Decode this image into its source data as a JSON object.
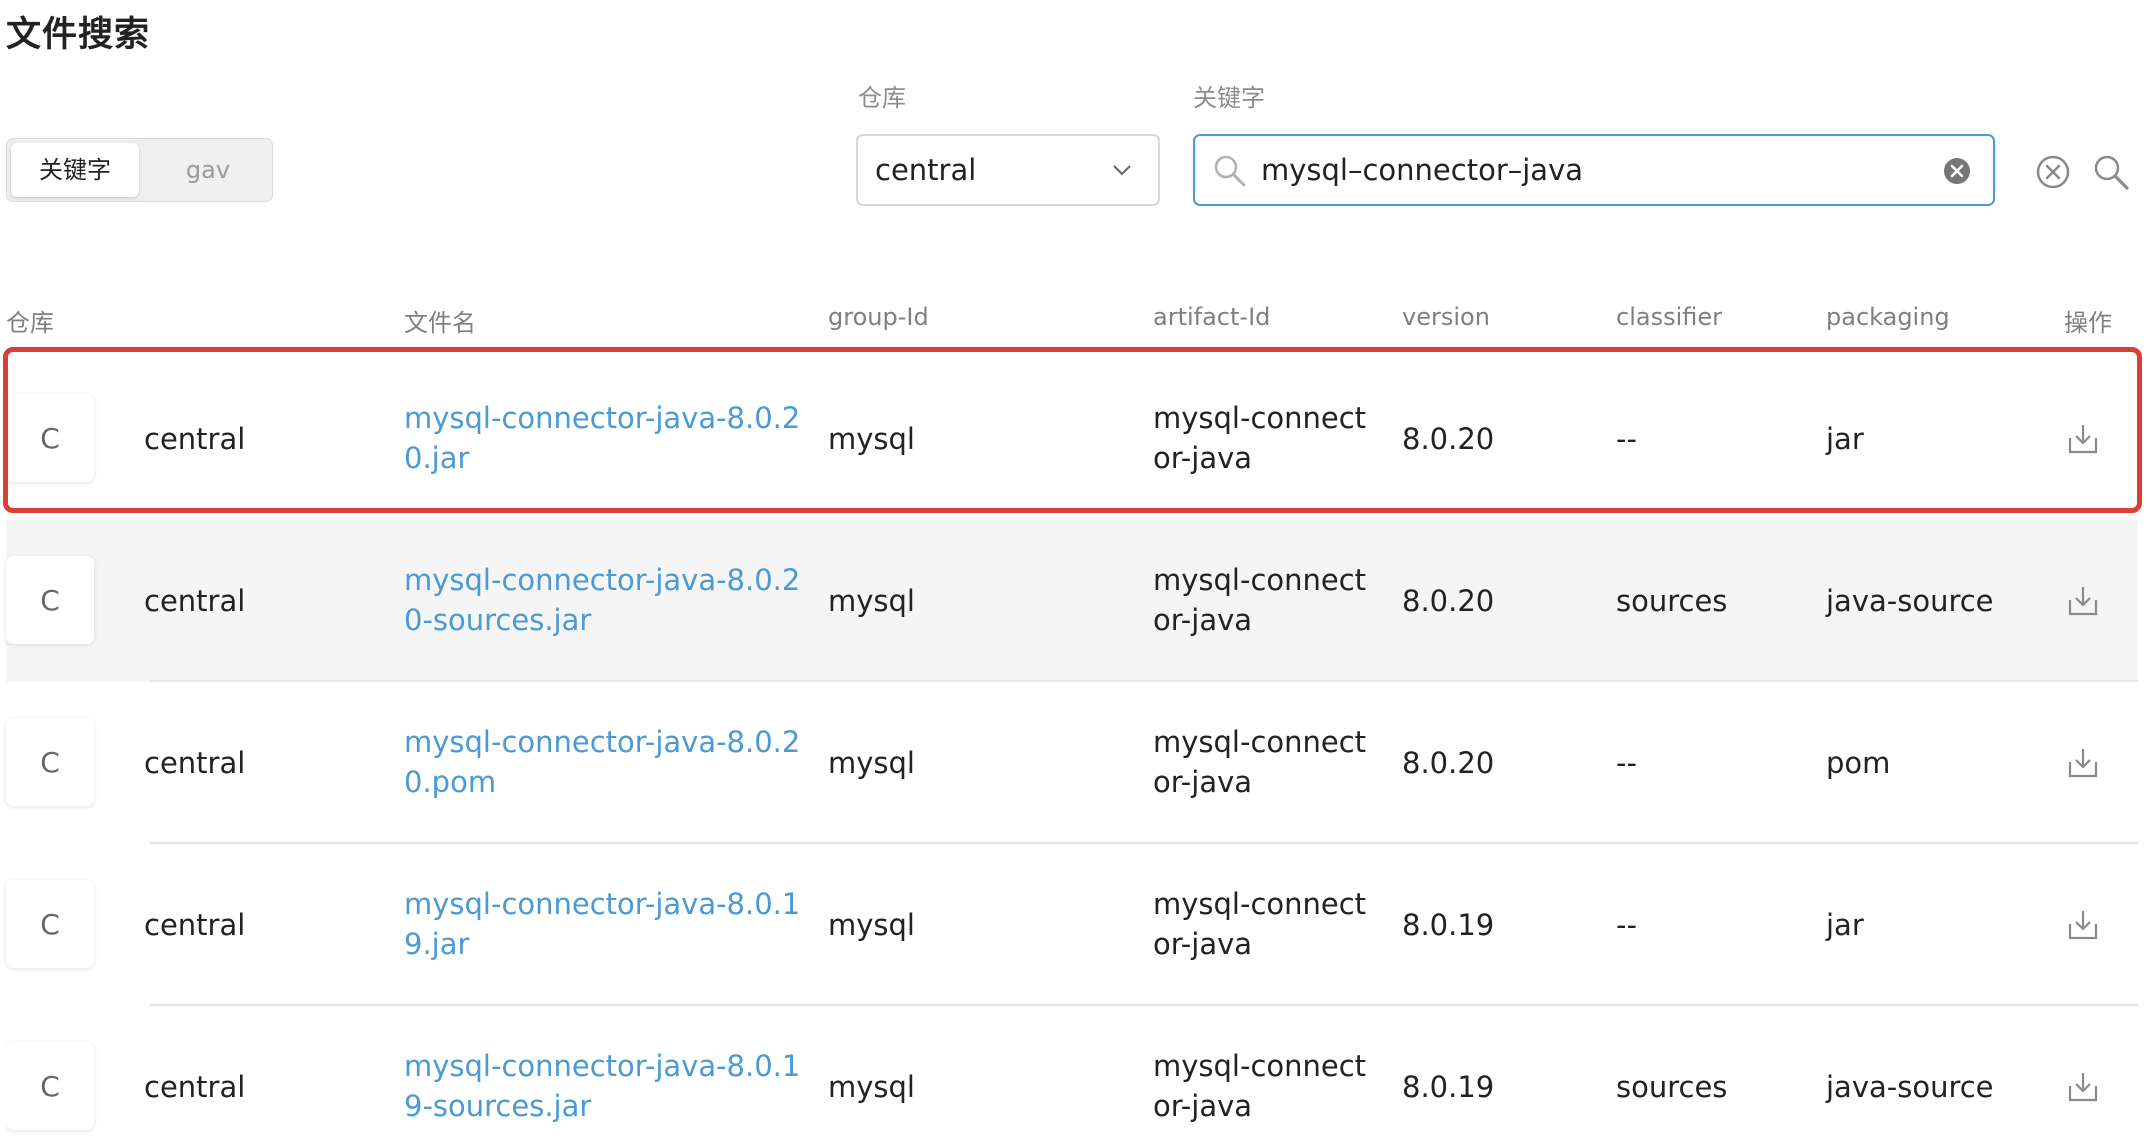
{
  "page": {
    "title": "文件搜索"
  },
  "mode_switch": {
    "options": [
      "关键字",
      "gav"
    ],
    "active": "关键字"
  },
  "filters": {
    "repo_label": "仓库",
    "repo_value": "central",
    "keyword_label": "关键字",
    "keyword_value": "mysql–connector–java"
  },
  "table": {
    "headers": [
      "仓库",
      "文件名",
      "group-Id",
      "artifact-Id",
      "version",
      "classifier",
      "packaging",
      "操作"
    ],
    "rows": [
      {
        "badge": "C",
        "repo": "central",
        "file_line1": "mysql-connector-java-8.0.2",
        "file_line2": "0.jar",
        "group": "mysql",
        "artifact_line1": "mysql-connect",
        "artifact_line2": "or-java",
        "version": "8.0.20",
        "classifier": "--",
        "packaging": "jar"
      },
      {
        "badge": "C",
        "repo": "central",
        "file_line1": "mysql-connector-java-8.0.2",
        "file_line2": "0-sources.jar",
        "group": "mysql",
        "artifact_line1": "mysql-connect",
        "artifact_line2": "or-java",
        "version": "8.0.20",
        "classifier": "sources",
        "packaging": "java-source"
      },
      {
        "badge": "C",
        "repo": "central",
        "file_line1": "mysql-connector-java-8.0.2",
        "file_line2": "0.pom",
        "group": "mysql",
        "artifact_line1": "mysql-connect",
        "artifact_line2": "or-java",
        "version": "8.0.20",
        "classifier": "--",
        "packaging": "pom"
      },
      {
        "badge": "C",
        "repo": "central",
        "file_line1": "mysql-connector-java-8.0.1",
        "file_line2": "9.jar",
        "group": "mysql",
        "artifact_line1": "mysql-connect",
        "artifact_line2": "or-java",
        "version": "8.0.19",
        "classifier": "--",
        "packaging": "jar"
      },
      {
        "badge": "C",
        "repo": "central",
        "file_line1": "mysql-connector-java-8.0.1",
        "file_line2": "9-sources.jar",
        "group": "mysql",
        "artifact_line1": "mysql-connect",
        "artifact_line2": "or-java",
        "version": "8.0.19",
        "classifier": "sources",
        "packaging": "java-source"
      }
    ]
  },
  "icons": {
    "chevron": "chevron-down-icon",
    "search": "search-icon",
    "clear": "clear-icon",
    "reset": "circle-close-icon",
    "download": "download-icon"
  },
  "colors": {
    "accent": "#4a9ad6",
    "highlight": "#d94035",
    "alt_row": "#f5f5f5"
  }
}
